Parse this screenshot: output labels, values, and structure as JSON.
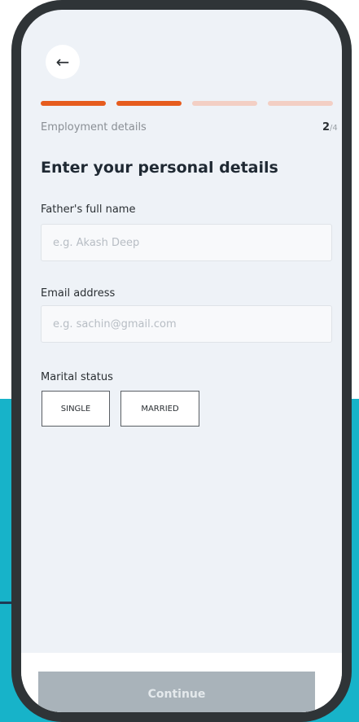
{
  "header": {
    "back_icon": "arrow-left-icon",
    "step_label": "Employment details",
    "step_current": "2",
    "step_total": "/4",
    "progress": {
      "completed": 2,
      "total": 4
    }
  },
  "form": {
    "title": "Enter your personal details",
    "fathers_name": {
      "label": "Father's full name",
      "placeholder": "e.g. Akash Deep"
    },
    "email": {
      "label": "Email address",
      "placeholder": "e.g. sachin@gmail.com"
    },
    "marital": {
      "label": "Marital status",
      "options": [
        "SINGLE",
        "MARRIED"
      ]
    }
  },
  "footer": {
    "continue_label": "Continue"
  },
  "colors": {
    "accent": "#e65c1e",
    "accent_light": "#f3cfc4",
    "disabled_button": "#a9b3ba",
    "backdrop": "#17b3c9",
    "annotation": "#1e3a55"
  }
}
